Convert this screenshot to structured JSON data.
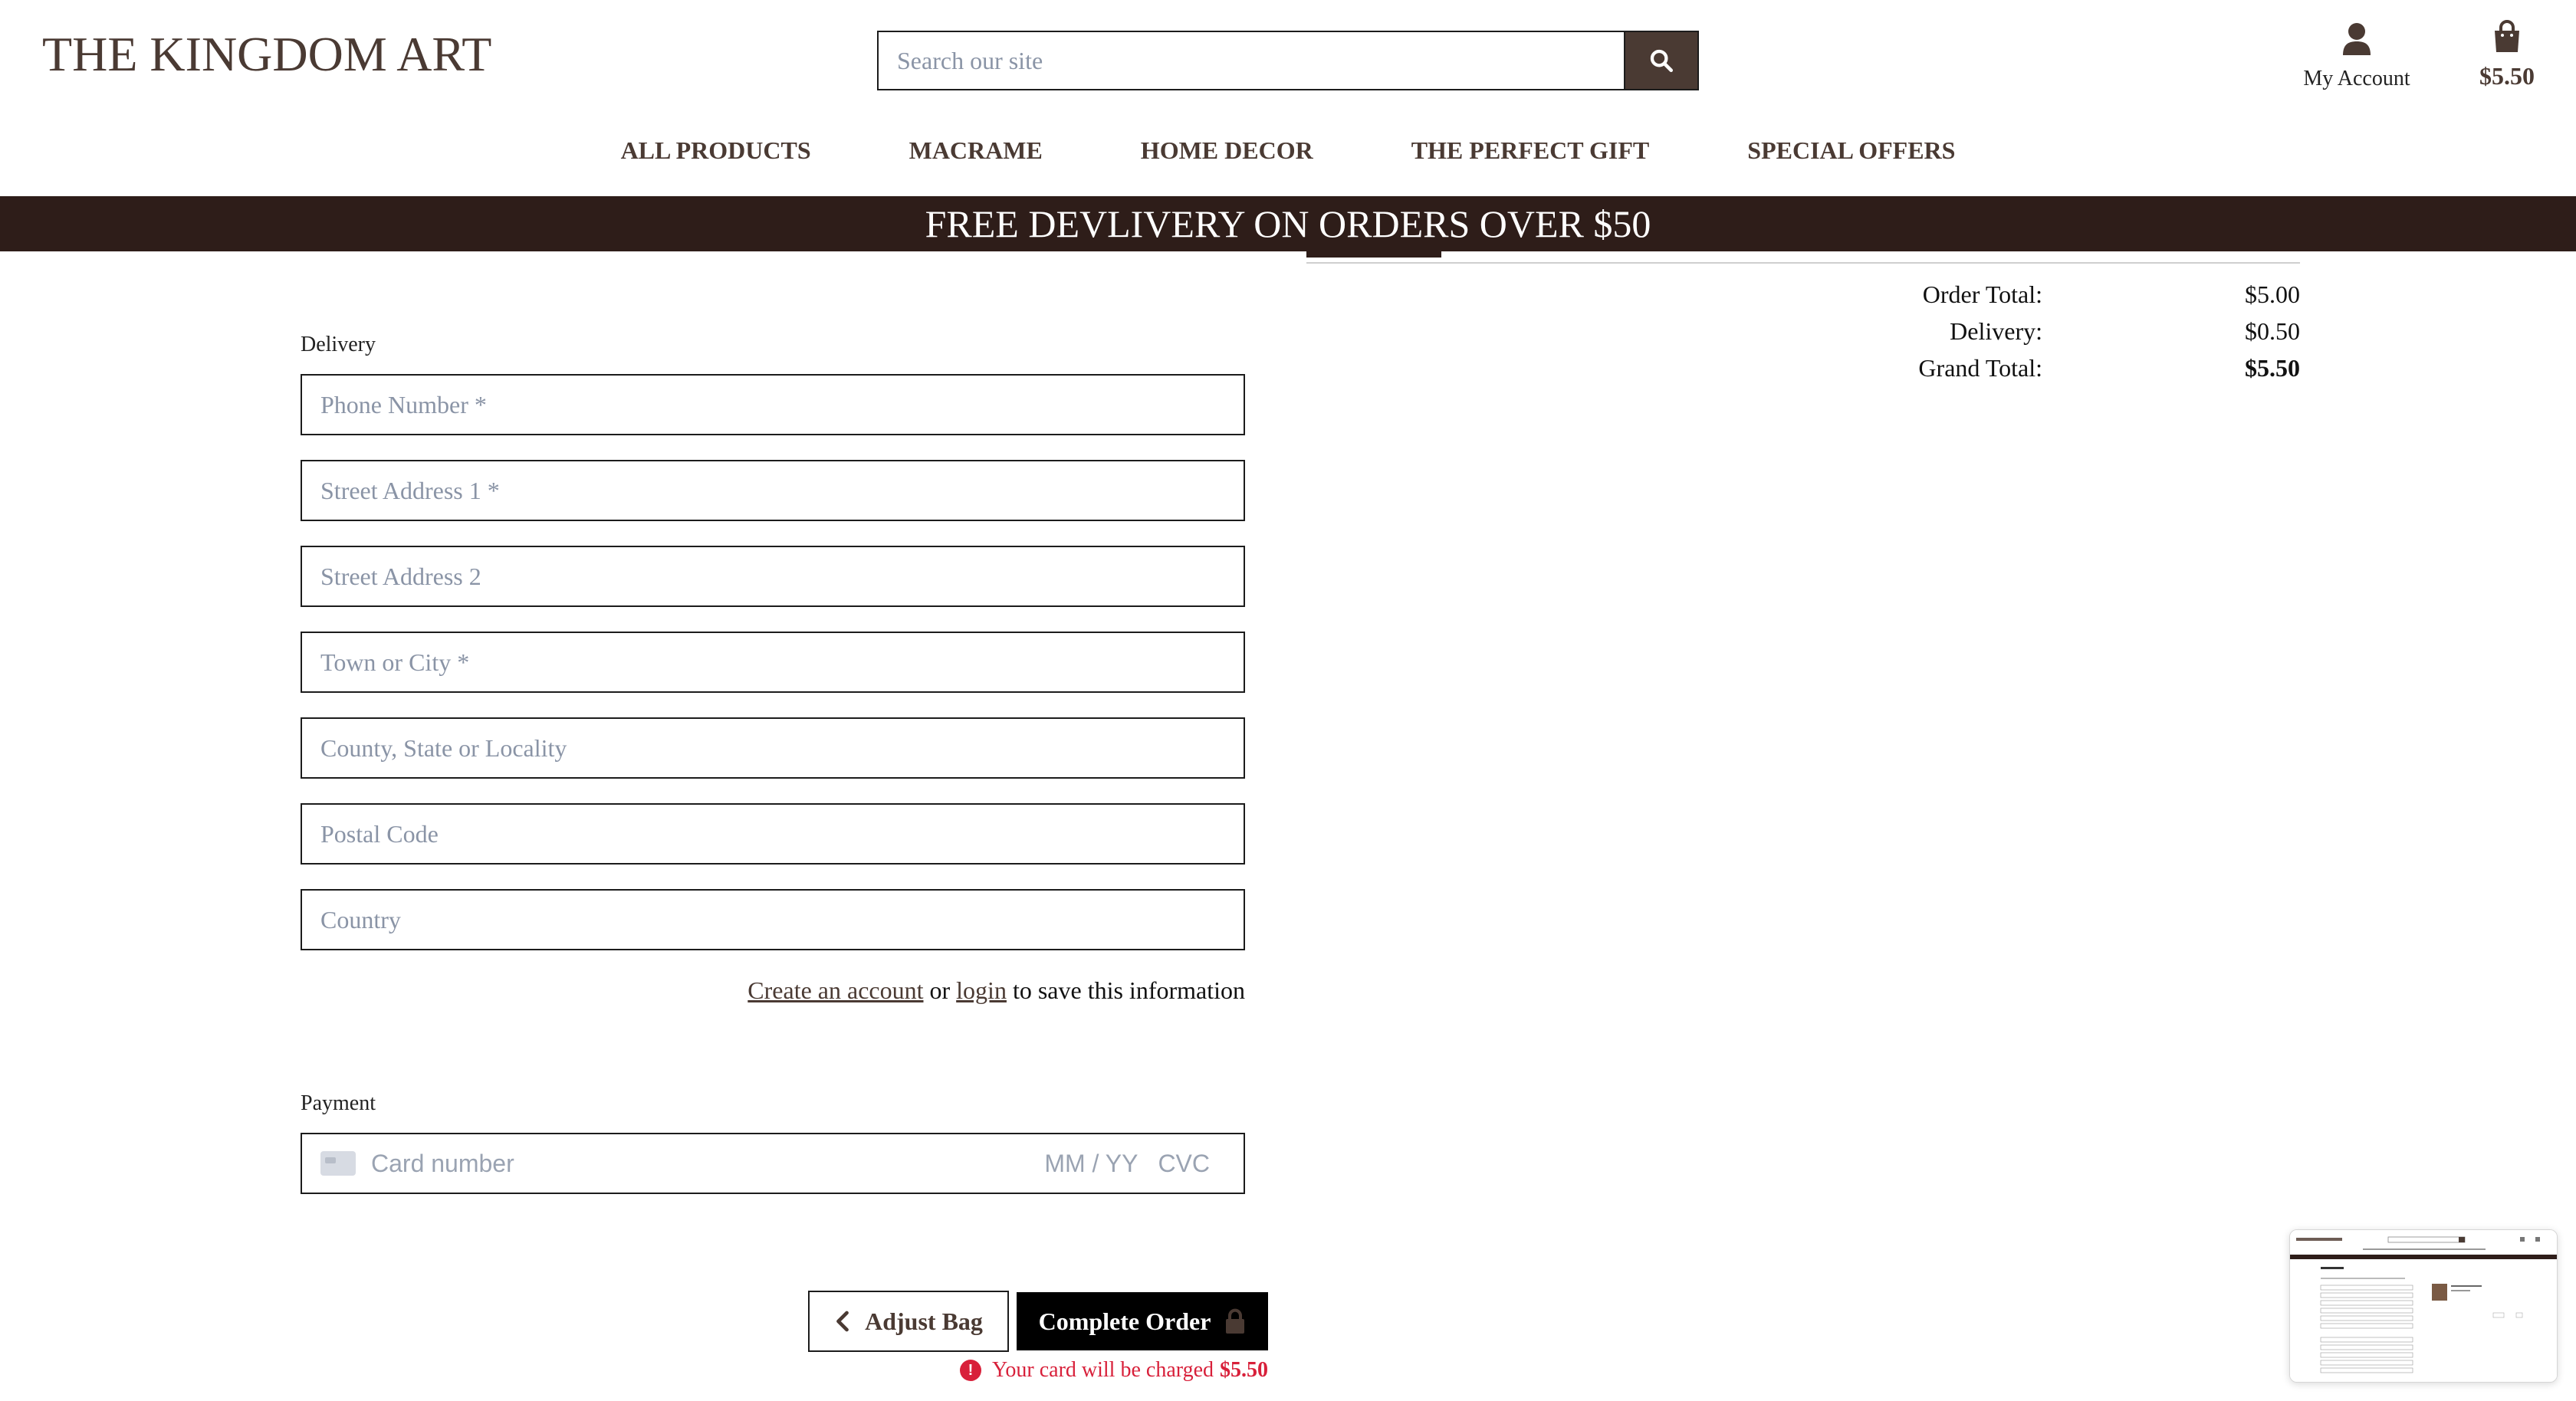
{
  "header": {
    "brand": "THE KINGDOM ART",
    "search_placeholder": "Search our site",
    "account_label": "My Account",
    "bag_total": "$5.50"
  },
  "nav": {
    "items": [
      "ALL PRODUCTS",
      "MACRAME",
      "HOME DECOR",
      "THE PERFECT GIFT",
      "SPECIAL OFFERS"
    ]
  },
  "banner": {
    "text": "FREE DEVLIVERY ON ORDERS OVER $50"
  },
  "summary": {
    "order_total_label": "Order Total:",
    "order_total_value": "$5.00",
    "delivery_label": "Delivery:",
    "delivery_value": "$0.50",
    "grand_total_label": "Grand Total:",
    "grand_total_value": "$5.50"
  },
  "delivery": {
    "label": "Delivery",
    "fields": [
      "Phone Number *",
      "Street Address 1 *",
      "Street Address 2",
      "Town or City *",
      "County, State or Locality",
      "Postal Code",
      "Country"
    ],
    "create_account_link": "Create an account",
    "or_text": "or",
    "login_link": "login",
    "save_text": "to save this information"
  },
  "payment": {
    "label": "Payment",
    "card_placeholder": "Card number",
    "expiry_placeholder": "MM / YY",
    "cvc_placeholder": "CVC"
  },
  "actions": {
    "adjust_bag": "Adjust Bag",
    "complete_order": "Complete Order",
    "charge_note": "Your card will be charged",
    "charge_amount": "$5.50"
  },
  "colors": {
    "brand_brown": "#4a3a33",
    "banner_bg": "#2e1d19",
    "error_red": "#d8203a"
  }
}
